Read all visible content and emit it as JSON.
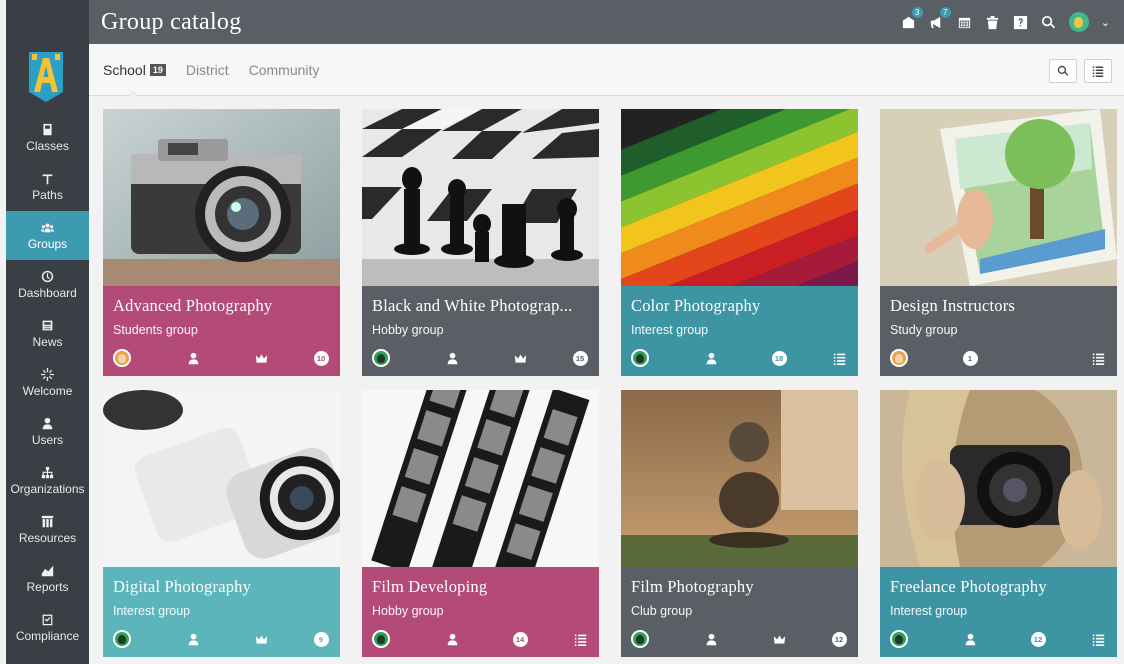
{
  "topbar": {
    "title": "Group catalog",
    "notification_badge": "3",
    "messages_badge": "7"
  },
  "sidebar": {
    "items": [
      {
        "label": "Classes",
        "icon": "classes-icon",
        "active": false
      },
      {
        "label": "Paths",
        "icon": "paths-icon",
        "active": false
      },
      {
        "label": "Groups",
        "icon": "groups-icon",
        "active": true
      },
      {
        "label": "Dashboard",
        "icon": "dashboard-icon",
        "active": false
      },
      {
        "label": "News",
        "icon": "news-icon",
        "active": false
      },
      {
        "label": "Welcome",
        "icon": "welcome-icon",
        "active": false
      },
      {
        "label": "Users",
        "icon": "users-icon",
        "active": false
      },
      {
        "label": "Organizations",
        "icon": "organizations-icon",
        "active": false
      },
      {
        "label": "Resources",
        "icon": "resources-icon",
        "active": false
      },
      {
        "label": "Reports",
        "icon": "reports-icon",
        "active": false
      },
      {
        "label": "Compliance",
        "icon": "compliance-icon",
        "active": false
      }
    ]
  },
  "tabs": [
    {
      "label": "School",
      "count": "19",
      "active": true
    },
    {
      "label": "District",
      "active": false
    },
    {
      "label": "Community",
      "active": false
    }
  ],
  "colors": {
    "pink": "#b34a77",
    "gray": "#5a5f66",
    "teal": "#3d95a3",
    "lightteal": "#5bb5bb",
    "accent": "#3d9bb0"
  },
  "cards": [
    {
      "title": "Advanced Photography",
      "subtitle": "Students group",
      "color": "#b34a77",
      "photo": "camera-photo",
      "owner": "orange",
      "count": "10",
      "count_pos": 3,
      "crown": true,
      "list": false
    },
    {
      "title": "Black and White Photograp...",
      "subtitle": "Hobby group",
      "color": "#5a5f66",
      "photo": "chess-photo",
      "owner": "green",
      "count": "15",
      "count_pos": 3,
      "crown": true,
      "list": false
    },
    {
      "title": "Color Photography",
      "subtitle": "Interest group",
      "color": "#3d95a3",
      "photo": "pencils-photo",
      "owner": "green",
      "count": "18",
      "count_pos": 2,
      "crown": false,
      "list": true
    },
    {
      "title": "Design Instructors",
      "subtitle": "Study group",
      "color": "#5a5f66",
      "photo": "painting-photo",
      "owner": "orange",
      "count": "1",
      "count_pos": 1,
      "crown": false,
      "list": true,
      "no_user": true
    },
    {
      "title": "Digital Photography",
      "subtitle": "Interest group",
      "color": "#5bb5bb",
      "photo": "white-camera-photo",
      "owner": "green",
      "count": "9",
      "count_pos": 3,
      "crown": true,
      "list": false
    },
    {
      "title": "Film Developing",
      "subtitle": "Hobby group",
      "color": "#b34a77",
      "photo": "film-photo",
      "owner": "green",
      "count": "14",
      "count_pos": 2,
      "crown": false,
      "list": true
    },
    {
      "title": "Film Photography",
      "subtitle": "Club group",
      "color": "#5a5f66",
      "photo": "stones-photo",
      "owner": "green",
      "count": "12",
      "count_pos": 3,
      "crown": true,
      "list": false
    },
    {
      "title": "Freelance Photography",
      "subtitle": "Interest group",
      "color": "#3d95a3",
      "photo": "photographer-photo",
      "owner": "green",
      "count": "12",
      "count_pos": 2,
      "crown": false,
      "list": true
    }
  ]
}
